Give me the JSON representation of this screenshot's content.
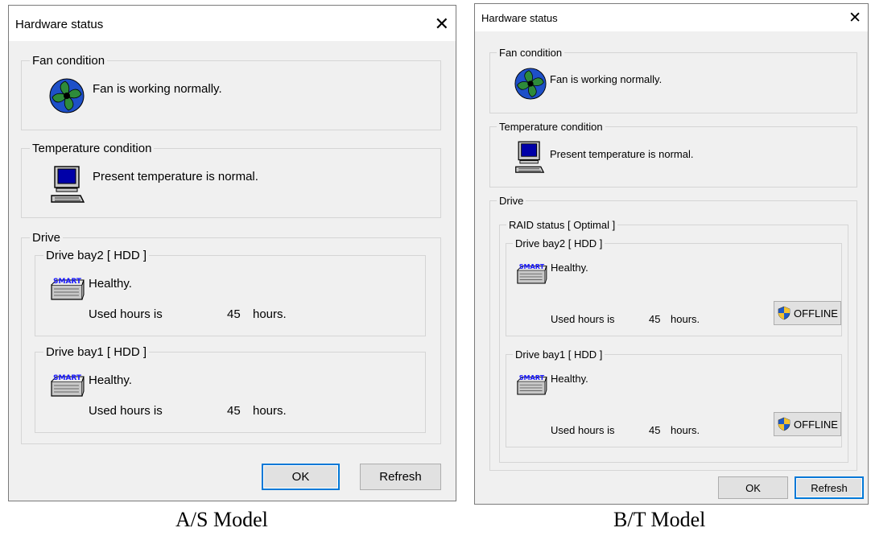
{
  "dialogs": [
    {
      "title": "Hardware status",
      "fan": {
        "legend": "Fan condition",
        "status": "Fan is working normally."
      },
      "temperature": {
        "legend": "Temperature condition",
        "status": "Present temperature is normal."
      },
      "drive": {
        "legend": "Drive",
        "bays": [
          {
            "legend": "Drive bay2 [ HDD ]",
            "health": "Healthy.",
            "used_label": "Used hours is",
            "hours": "45",
            "unit": "hours."
          },
          {
            "legend": "Drive bay1 [ HDD ]",
            "health": "Healthy.",
            "used_label": "Used hours is",
            "hours": "45",
            "unit": "hours."
          }
        ]
      },
      "buttons": {
        "ok": "OK",
        "refresh": "Refresh"
      },
      "caption": "A/S Model"
    },
    {
      "title": "Hardware status",
      "fan": {
        "legend": "Fan condition",
        "status": "Fan is working normally."
      },
      "temperature": {
        "legend": "Temperature condition",
        "status": "Present temperature is normal."
      },
      "drive": {
        "legend": "Drive",
        "raid_legend": "RAID status [ Optimal ]",
        "bays": [
          {
            "legend": "Drive bay2 [ HDD ]",
            "health": "Healthy.",
            "used_label": "Used hours is",
            "hours": "45",
            "unit": "hours.",
            "offline_label": "OFFLINE"
          },
          {
            "legend": "Drive bay1 [ HDD ]",
            "health": "Healthy.",
            "used_label": "Used hours is",
            "hours": "45",
            "unit": "hours.",
            "offline_label": "OFFLINE"
          }
        ]
      },
      "buttons": {
        "ok": "OK",
        "refresh": "Refresh"
      },
      "caption": "B/T Model"
    }
  ],
  "icons": {
    "fan": "fan-icon",
    "computer": "computer-icon",
    "smart_drive": "smart-drive-icon",
    "shield": "shield-icon",
    "close": "close-icon"
  },
  "colors": {
    "dialog_bg": "#f0f0f0",
    "titlebar_bg": "#ffffff",
    "default_button_border": "#0078d7",
    "fan_green": "#2e8b3a",
    "fan_blue": "#1e50c8",
    "screen_blue": "#0000a8",
    "smart_text": "#1a1aff"
  }
}
